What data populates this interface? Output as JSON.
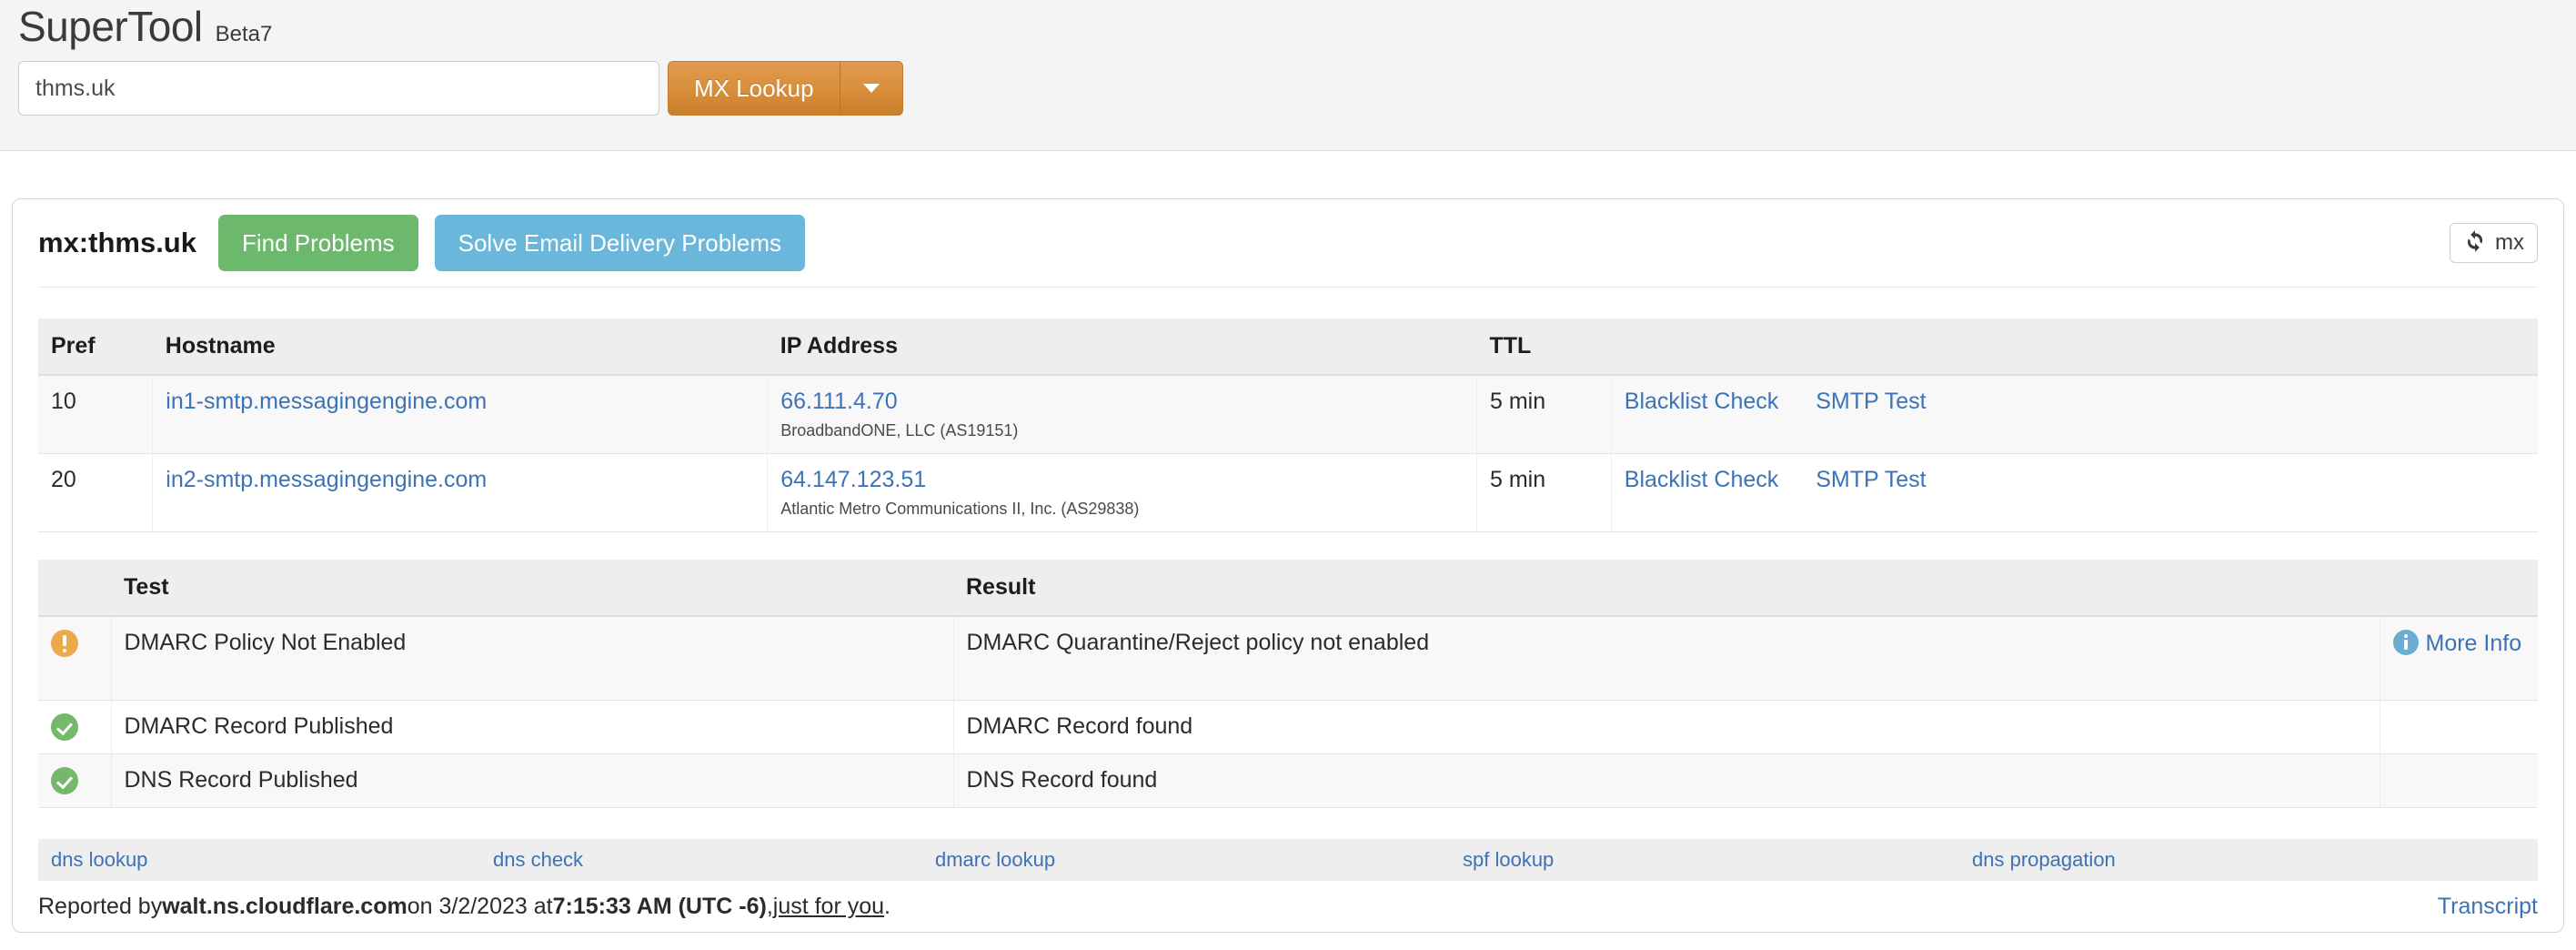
{
  "header": {
    "brand": "SuperTool",
    "beta": "Beta7",
    "search": {
      "value": "thms.uk",
      "placeholder": "Domain Name, IP or hostname"
    },
    "lookup_button": "MX Lookup",
    "caret_icon": "chevron-down-icon"
  },
  "result": {
    "query_title": "mx:thms.uk",
    "find_problems_label": "Find Problems",
    "solve_problems_label": "Solve Email Delivery Problems",
    "refresh": {
      "icon": "refresh-icon",
      "label": "mx"
    },
    "mx_table": {
      "columns": [
        "Pref",
        "Hostname",
        "IP Address",
        "TTL",
        ""
      ],
      "rows": [
        {
          "pref": "10",
          "hostname": "in1-smtp.messagingengine.com",
          "ip": "66.111.4.70",
          "asn": "BroadbandONE, LLC (AS19151)",
          "ttl": "5 min",
          "actions": [
            "Blacklist Check",
            "SMTP Test"
          ]
        },
        {
          "pref": "20",
          "hostname": "in2-smtp.messagingengine.com",
          "ip": "64.147.123.51",
          "asn": "Atlantic Metro Communications II, Inc. (AS29838)",
          "ttl": "5 min",
          "actions": [
            "Blacklist Check",
            "SMTP Test"
          ]
        }
      ]
    },
    "tests_table": {
      "columns": [
        "",
        "Test",
        "Result",
        ""
      ],
      "rows": [
        {
          "status": "warning-icon",
          "test": "DMARC Policy Not Enabled",
          "result": "DMARC Quarantine/Reject policy not enabled",
          "more_info": "More Info",
          "more_info_icon": "info-icon"
        },
        {
          "status": "success-icon",
          "test": "DMARC Record Published",
          "result": "DMARC Record found",
          "more_info": "",
          "more_info_icon": ""
        },
        {
          "status": "success-icon",
          "test": "DNS Record Published",
          "result": "DNS Record found",
          "more_info": "",
          "more_info_icon": ""
        }
      ]
    },
    "footer": {
      "links": [
        "dns lookup",
        "dns check",
        "dmarc lookup",
        "spf lookup",
        "dns propagation"
      ],
      "note": {
        "prefix": "Reported by ",
        "server": "walt.ns.cloudflare.com",
        "mid": " on 3/2/2023 at ",
        "time": "7:15:33 AM (UTC -6)",
        "comma": ", ",
        "just_for_you": "just for you",
        "period": "."
      },
      "transcript": "Transcript"
    }
  },
  "colors": {
    "accent_orange": "#d98f3c",
    "success_green": "#6cb86c",
    "info_blue": "#6bb7dc",
    "link_blue": "#3d72b4",
    "warning_amber": "#ecaa4a"
  }
}
